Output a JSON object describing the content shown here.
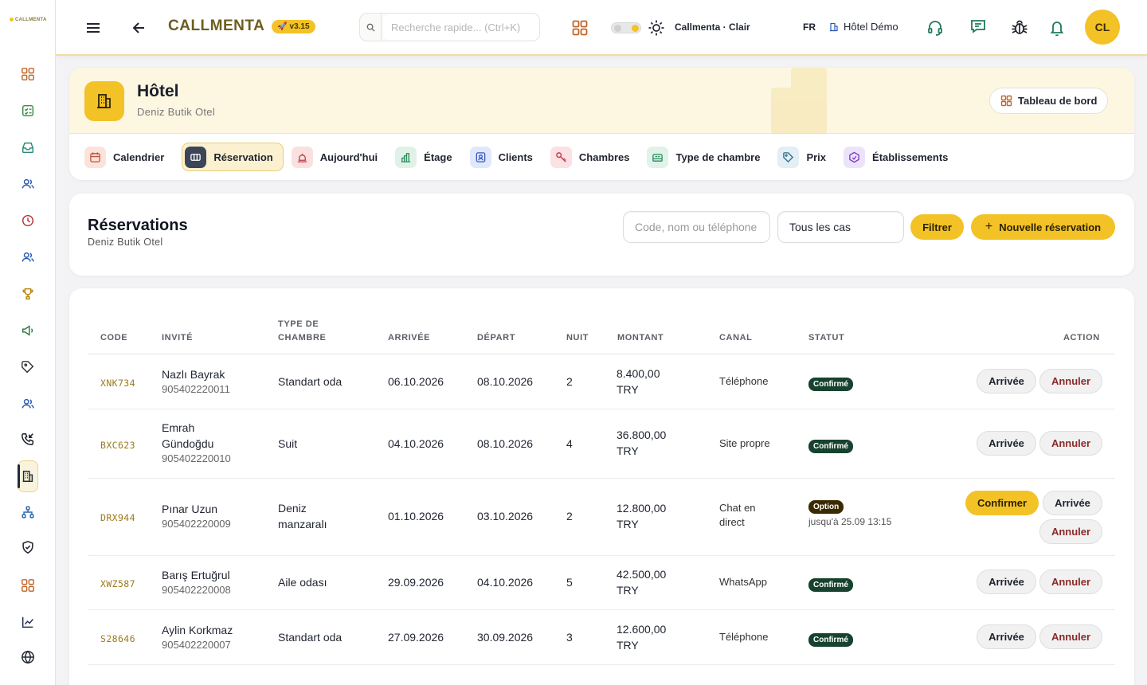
{
  "app": {
    "logo_text": "CALLMENTA",
    "brand": "CALLMENTA",
    "version": "v3.15",
    "search_placeholder": "Recherche rapide... (Ctrl+K)",
    "theme_label": "Callmenta · Clair",
    "language": "FR",
    "hotel_selector": "Hôtel Démo",
    "avatar_initials": "CL"
  },
  "colors": {
    "accent": "#f3c226",
    "navy": "#1f2a3d",
    "confirmed": "#17432e",
    "option": "#3a2a00"
  },
  "sidebar": {
    "items": [
      "grid-icon",
      "checklist-icon",
      "inbox-icon",
      "users-icon",
      "clock-icon",
      "team-icon",
      "trophy-icon",
      "megaphone-icon",
      "tag-icon",
      "staff-icon",
      "phone-incoming-icon",
      "building-icon",
      "network-icon",
      "shield-icon",
      "apps-icon",
      "chart-icon",
      "globe-icon"
    ],
    "active": "building-icon"
  },
  "hotel": {
    "title": "Hôtel",
    "subtitle": "Deniz Butik Otel",
    "dashboard_label": "Tableau de bord",
    "tabs": [
      {
        "label": "Calendrier",
        "icon": "calendar-icon",
        "color": "#fbe3dc"
      },
      {
        "label": "Réservation",
        "icon": "bed-icon",
        "color": "#3c4658",
        "active": true
      },
      {
        "label": "Aujourd'hui",
        "icon": "bell-icon",
        "color": "#fbe0e0"
      },
      {
        "label": "Étage",
        "icon": "stairs-icon",
        "color": "#e0f2e8"
      },
      {
        "label": "Clients",
        "icon": "id-icon",
        "color": "#e0e8fb"
      },
      {
        "label": "Chambres",
        "icon": "key-icon",
        "color": "#fbe0e4"
      },
      {
        "label": "Type de chambre",
        "icon": "room-type-icon",
        "color": "#e0f2ea"
      },
      {
        "label": "Prix",
        "icon": "price-tag-icon",
        "color": "#e3eef5"
      },
      {
        "label": "Établissements",
        "icon": "property-icon",
        "color": "#ece3fb"
      }
    ]
  },
  "reservations": {
    "title": "Réservations",
    "subtitle": "Deniz Butik Otel",
    "search_placeholder": "Code, nom ou téléphone",
    "status_filter": "Tous les cas",
    "filter_label": "Filtrer",
    "new_label": "Nouvelle réservation"
  },
  "table": {
    "headers": {
      "code": "CODE",
      "guest": "INVITÉ",
      "room_type_1": "TYPE DE",
      "room_type_2": "CHAMBRE",
      "arrival": "ARRIVÉE",
      "departure": "DÉPART",
      "nights": "NUIT",
      "amount": "MONTANT",
      "channel": "CANAL",
      "status": "STATUT",
      "action": "ACTION"
    },
    "labels": {
      "arrive": "Arrivée",
      "cancel": "Annuler",
      "confirm": "Confirmer"
    },
    "rows": [
      {
        "code": "XNK734",
        "name": "Nazlı Bayrak",
        "phone": "905402220011",
        "room": "Standart oda",
        "arrival": "06.10.2026",
        "departure": "08.10.2026",
        "nights": "2",
        "amount": "8.400,00",
        "currency": "TRY",
        "channel": "Téléphone",
        "status": "Confirmé"
      },
      {
        "code": "BXC623",
        "name": "Emrah Gündoğdu",
        "phone": "905402220010",
        "room": "Suit",
        "arrival": "04.10.2026",
        "departure": "08.10.2026",
        "nights": "4",
        "amount": "36.800,00",
        "currency": "TRY",
        "channel": "Site propre",
        "status": "Confirmé"
      },
      {
        "code": "DRX944",
        "name": "Pınar Uzun",
        "phone": "905402220009",
        "room": "Deniz manzaralı",
        "arrival": "01.10.2026",
        "departure": "03.10.2026",
        "nights": "2",
        "amount": "12.800,00",
        "currency": "TRY",
        "channel": "Chat en direct",
        "status": "Option",
        "option_until": "jusqu'à 25.09 13:15"
      },
      {
        "code": "XWZ587",
        "name": "Barış Ertuğrul",
        "phone": "905402220008",
        "room": "Aile odası",
        "arrival": "29.09.2026",
        "departure": "04.10.2026",
        "nights": "5",
        "amount": "42.500,00",
        "currency": "TRY",
        "channel": "WhatsApp",
        "status": "Confirmé"
      },
      {
        "code": "S28646",
        "name": "Aylin Korkmaz",
        "phone": "905402220007",
        "room": "Standart oda",
        "arrival": "27.09.2026",
        "departure": "30.09.2026",
        "nights": "3",
        "amount": "12.600,00",
        "currency": "TRY",
        "channel": "Téléphone",
        "status": "Confirmé"
      }
    ]
  }
}
